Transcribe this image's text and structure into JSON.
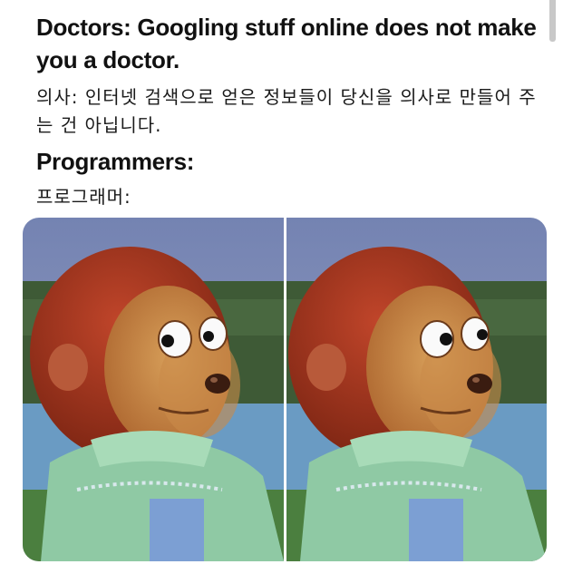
{
  "caption": {
    "doctors_en": "Doctors:  Googling stuff online does not make you a doctor.",
    "doctors_ko": "의사: 인터넷 검색으로 얻은 정보들이 당신을 의사로 만들어 주는 건 아닙니다.",
    "programmers_en": "Programmers:",
    "programmers_ko": "프로그래머:"
  },
  "meme": {
    "panels": [
      "puppet-looking-side",
      "puppet-looking-away"
    ],
    "colors": {
      "sky": "#7f8fb6",
      "trees": "#3f5a38",
      "water": "#6fa0c4",
      "fur": "#a8321d",
      "face": "#c98a4a",
      "shirt": "#8fc9a4"
    }
  }
}
